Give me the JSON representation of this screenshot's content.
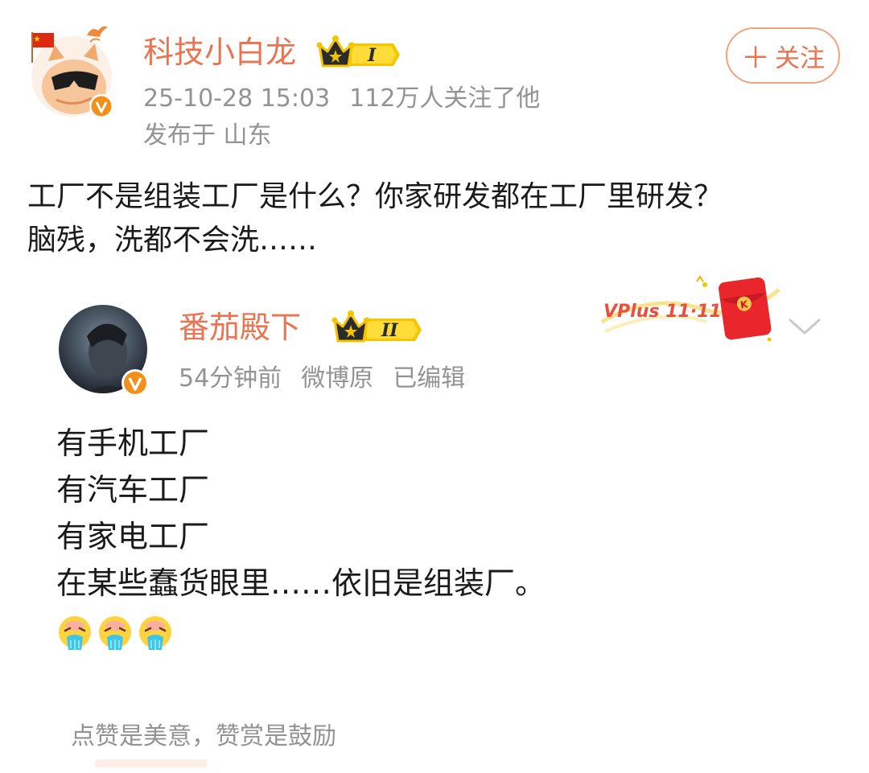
{
  "post": {
    "author_name": "科技小白龙",
    "level_badge": "I",
    "timestamp": "25-10-28 15:03",
    "followers": "112万人关注了他",
    "location": "发布于 山东",
    "follow_label": "关注",
    "text_lines": [
      "工厂不是组装工厂是什么？你家研发都在工厂里研发？",
      "脑残，洗都不会洗……"
    ]
  },
  "repost": {
    "author_name": "番茄殿下",
    "level_badge": "II",
    "time_ago": "54分钟前",
    "source": "微博原",
    "edited": "已编辑",
    "vplus_label": "VPlus 11·11",
    "text_lines": [
      "有手机工厂",
      "有汽车工厂",
      "有家电工厂",
      "在某些蠢货眼里……依旧是组装厂。"
    ],
    "emoji_count": 3,
    "emoji_name": "vomit-emoji"
  },
  "reward_text": "点赞是美意，赞赏是鼓励",
  "colors": {
    "accent": "#eb7350",
    "meta_gray": "#939393",
    "verified_orange": "#f3901b",
    "gold": "#f5c400"
  }
}
